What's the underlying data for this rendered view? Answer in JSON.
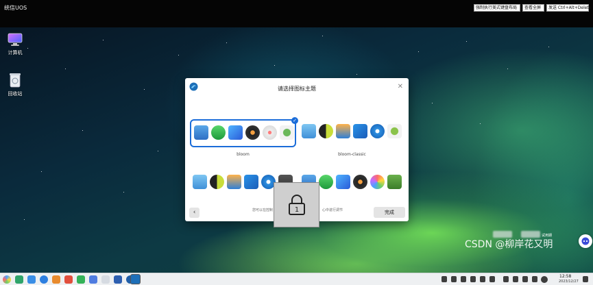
{
  "console": {
    "title": "统信UOS",
    "buttons": {
      "keyboard_layout": "强制执行美式键盘布局",
      "fullscreen": "查看全屏",
      "send_cad": "发送 Ctrl+Alt+Delete"
    }
  },
  "desktop": {
    "icons": [
      {
        "label": "计算机",
        "icon": "computer-icon"
      },
      {
        "label": "回收站",
        "icon": "trash-icon"
      }
    ],
    "trial_text": "试用期",
    "watermark": "CSDN @柳岸花又明"
  },
  "dialog": {
    "title": "请选择图标主题",
    "themes": [
      {
        "name": "bloom",
        "selected": true
      },
      {
        "name": "bloom-classic",
        "selected": false
      },
      {
        "name": "",
        "selected": false
      },
      {
        "name": "",
        "selected": false
      }
    ],
    "hint_left": "您可以在控制",
    "hint_right": "心中进行调节",
    "done_label": "完成",
    "lock_number": "1"
  },
  "taskbar": {
    "time": "12:58",
    "date": "2023/12/27"
  },
  "colors": {
    "accent": "#1a6cd9",
    "dialog_bg": "#ffffff",
    "taskbar_bg": "#eef0f2",
    "console_bg": "#050505"
  }
}
